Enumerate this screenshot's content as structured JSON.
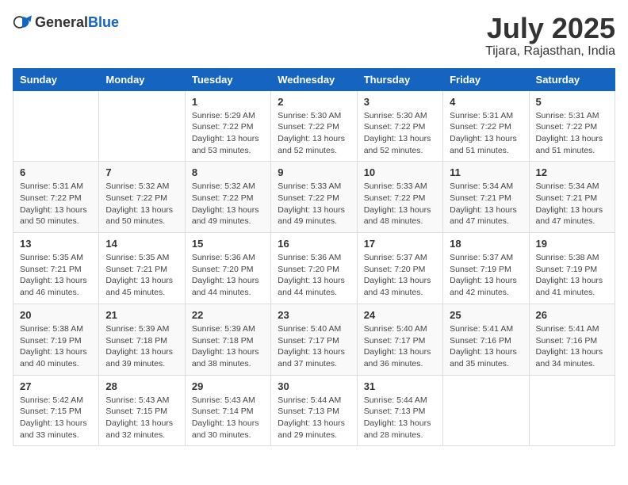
{
  "logo": {
    "general": "General",
    "blue": "Blue"
  },
  "header": {
    "month": "July 2025",
    "location": "Tijara, Rajasthan, India"
  },
  "weekdays": [
    "Sunday",
    "Monday",
    "Tuesday",
    "Wednesday",
    "Thursday",
    "Friday",
    "Saturday"
  ],
  "weeks": [
    [
      {
        "day": "",
        "detail": ""
      },
      {
        "day": "",
        "detail": ""
      },
      {
        "day": "1",
        "detail": "Sunrise: 5:29 AM\nSunset: 7:22 PM\nDaylight: 13 hours and 53 minutes."
      },
      {
        "day": "2",
        "detail": "Sunrise: 5:30 AM\nSunset: 7:22 PM\nDaylight: 13 hours and 52 minutes."
      },
      {
        "day": "3",
        "detail": "Sunrise: 5:30 AM\nSunset: 7:22 PM\nDaylight: 13 hours and 52 minutes."
      },
      {
        "day": "4",
        "detail": "Sunrise: 5:31 AM\nSunset: 7:22 PM\nDaylight: 13 hours and 51 minutes."
      },
      {
        "day": "5",
        "detail": "Sunrise: 5:31 AM\nSunset: 7:22 PM\nDaylight: 13 hours and 51 minutes."
      }
    ],
    [
      {
        "day": "6",
        "detail": "Sunrise: 5:31 AM\nSunset: 7:22 PM\nDaylight: 13 hours and 50 minutes."
      },
      {
        "day": "7",
        "detail": "Sunrise: 5:32 AM\nSunset: 7:22 PM\nDaylight: 13 hours and 50 minutes."
      },
      {
        "day": "8",
        "detail": "Sunrise: 5:32 AM\nSunset: 7:22 PM\nDaylight: 13 hours and 49 minutes."
      },
      {
        "day": "9",
        "detail": "Sunrise: 5:33 AM\nSunset: 7:22 PM\nDaylight: 13 hours and 49 minutes."
      },
      {
        "day": "10",
        "detail": "Sunrise: 5:33 AM\nSunset: 7:22 PM\nDaylight: 13 hours and 48 minutes."
      },
      {
        "day": "11",
        "detail": "Sunrise: 5:34 AM\nSunset: 7:21 PM\nDaylight: 13 hours and 47 minutes."
      },
      {
        "day": "12",
        "detail": "Sunrise: 5:34 AM\nSunset: 7:21 PM\nDaylight: 13 hours and 47 minutes."
      }
    ],
    [
      {
        "day": "13",
        "detail": "Sunrise: 5:35 AM\nSunset: 7:21 PM\nDaylight: 13 hours and 46 minutes."
      },
      {
        "day": "14",
        "detail": "Sunrise: 5:35 AM\nSunset: 7:21 PM\nDaylight: 13 hours and 45 minutes."
      },
      {
        "day": "15",
        "detail": "Sunrise: 5:36 AM\nSunset: 7:20 PM\nDaylight: 13 hours and 44 minutes."
      },
      {
        "day": "16",
        "detail": "Sunrise: 5:36 AM\nSunset: 7:20 PM\nDaylight: 13 hours and 44 minutes."
      },
      {
        "day": "17",
        "detail": "Sunrise: 5:37 AM\nSunset: 7:20 PM\nDaylight: 13 hours and 43 minutes."
      },
      {
        "day": "18",
        "detail": "Sunrise: 5:37 AM\nSunset: 7:19 PM\nDaylight: 13 hours and 42 minutes."
      },
      {
        "day": "19",
        "detail": "Sunrise: 5:38 AM\nSunset: 7:19 PM\nDaylight: 13 hours and 41 minutes."
      }
    ],
    [
      {
        "day": "20",
        "detail": "Sunrise: 5:38 AM\nSunset: 7:19 PM\nDaylight: 13 hours and 40 minutes."
      },
      {
        "day": "21",
        "detail": "Sunrise: 5:39 AM\nSunset: 7:18 PM\nDaylight: 13 hours and 39 minutes."
      },
      {
        "day": "22",
        "detail": "Sunrise: 5:39 AM\nSunset: 7:18 PM\nDaylight: 13 hours and 38 minutes."
      },
      {
        "day": "23",
        "detail": "Sunrise: 5:40 AM\nSunset: 7:17 PM\nDaylight: 13 hours and 37 minutes."
      },
      {
        "day": "24",
        "detail": "Sunrise: 5:40 AM\nSunset: 7:17 PM\nDaylight: 13 hours and 36 minutes."
      },
      {
        "day": "25",
        "detail": "Sunrise: 5:41 AM\nSunset: 7:16 PM\nDaylight: 13 hours and 35 minutes."
      },
      {
        "day": "26",
        "detail": "Sunrise: 5:41 AM\nSunset: 7:16 PM\nDaylight: 13 hours and 34 minutes."
      }
    ],
    [
      {
        "day": "27",
        "detail": "Sunrise: 5:42 AM\nSunset: 7:15 PM\nDaylight: 13 hours and 33 minutes."
      },
      {
        "day": "28",
        "detail": "Sunrise: 5:43 AM\nSunset: 7:15 PM\nDaylight: 13 hours and 32 minutes."
      },
      {
        "day": "29",
        "detail": "Sunrise: 5:43 AM\nSunset: 7:14 PM\nDaylight: 13 hours and 30 minutes."
      },
      {
        "day": "30",
        "detail": "Sunrise: 5:44 AM\nSunset: 7:13 PM\nDaylight: 13 hours and 29 minutes."
      },
      {
        "day": "31",
        "detail": "Sunrise: 5:44 AM\nSunset: 7:13 PM\nDaylight: 13 hours and 28 minutes."
      },
      {
        "day": "",
        "detail": ""
      },
      {
        "day": "",
        "detail": ""
      }
    ]
  ]
}
